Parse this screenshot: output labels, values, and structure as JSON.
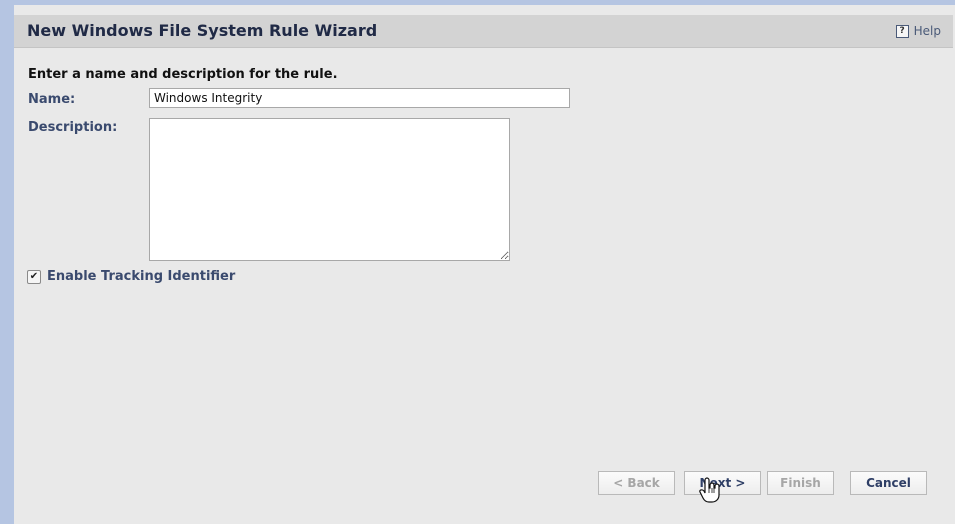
{
  "wizard": {
    "title": "New Windows File System Rule Wizard",
    "help_label": "Help",
    "help_icon": "?"
  },
  "form": {
    "instruction": "Enter a name and description for the rule.",
    "name_label": "Name:",
    "name_value": "Windows Integrity",
    "description_label": "Description:",
    "description_value": "",
    "tracking_label": "Enable Tracking Identifier",
    "tracking_checked": true
  },
  "buttons": {
    "back": "< Back",
    "next": "Next >",
    "finish": "Finish",
    "cancel": "Cancel"
  },
  "icons": {
    "help": "help-icon",
    "checkbox": "check-icon",
    "cursor": "hand-pointer-icon"
  },
  "colors": {
    "title_bar": "#d3d3d3",
    "panel": "#e9e9e9",
    "accent_stripe": "#b5c5e2",
    "label_text": "#3a4a6e"
  }
}
